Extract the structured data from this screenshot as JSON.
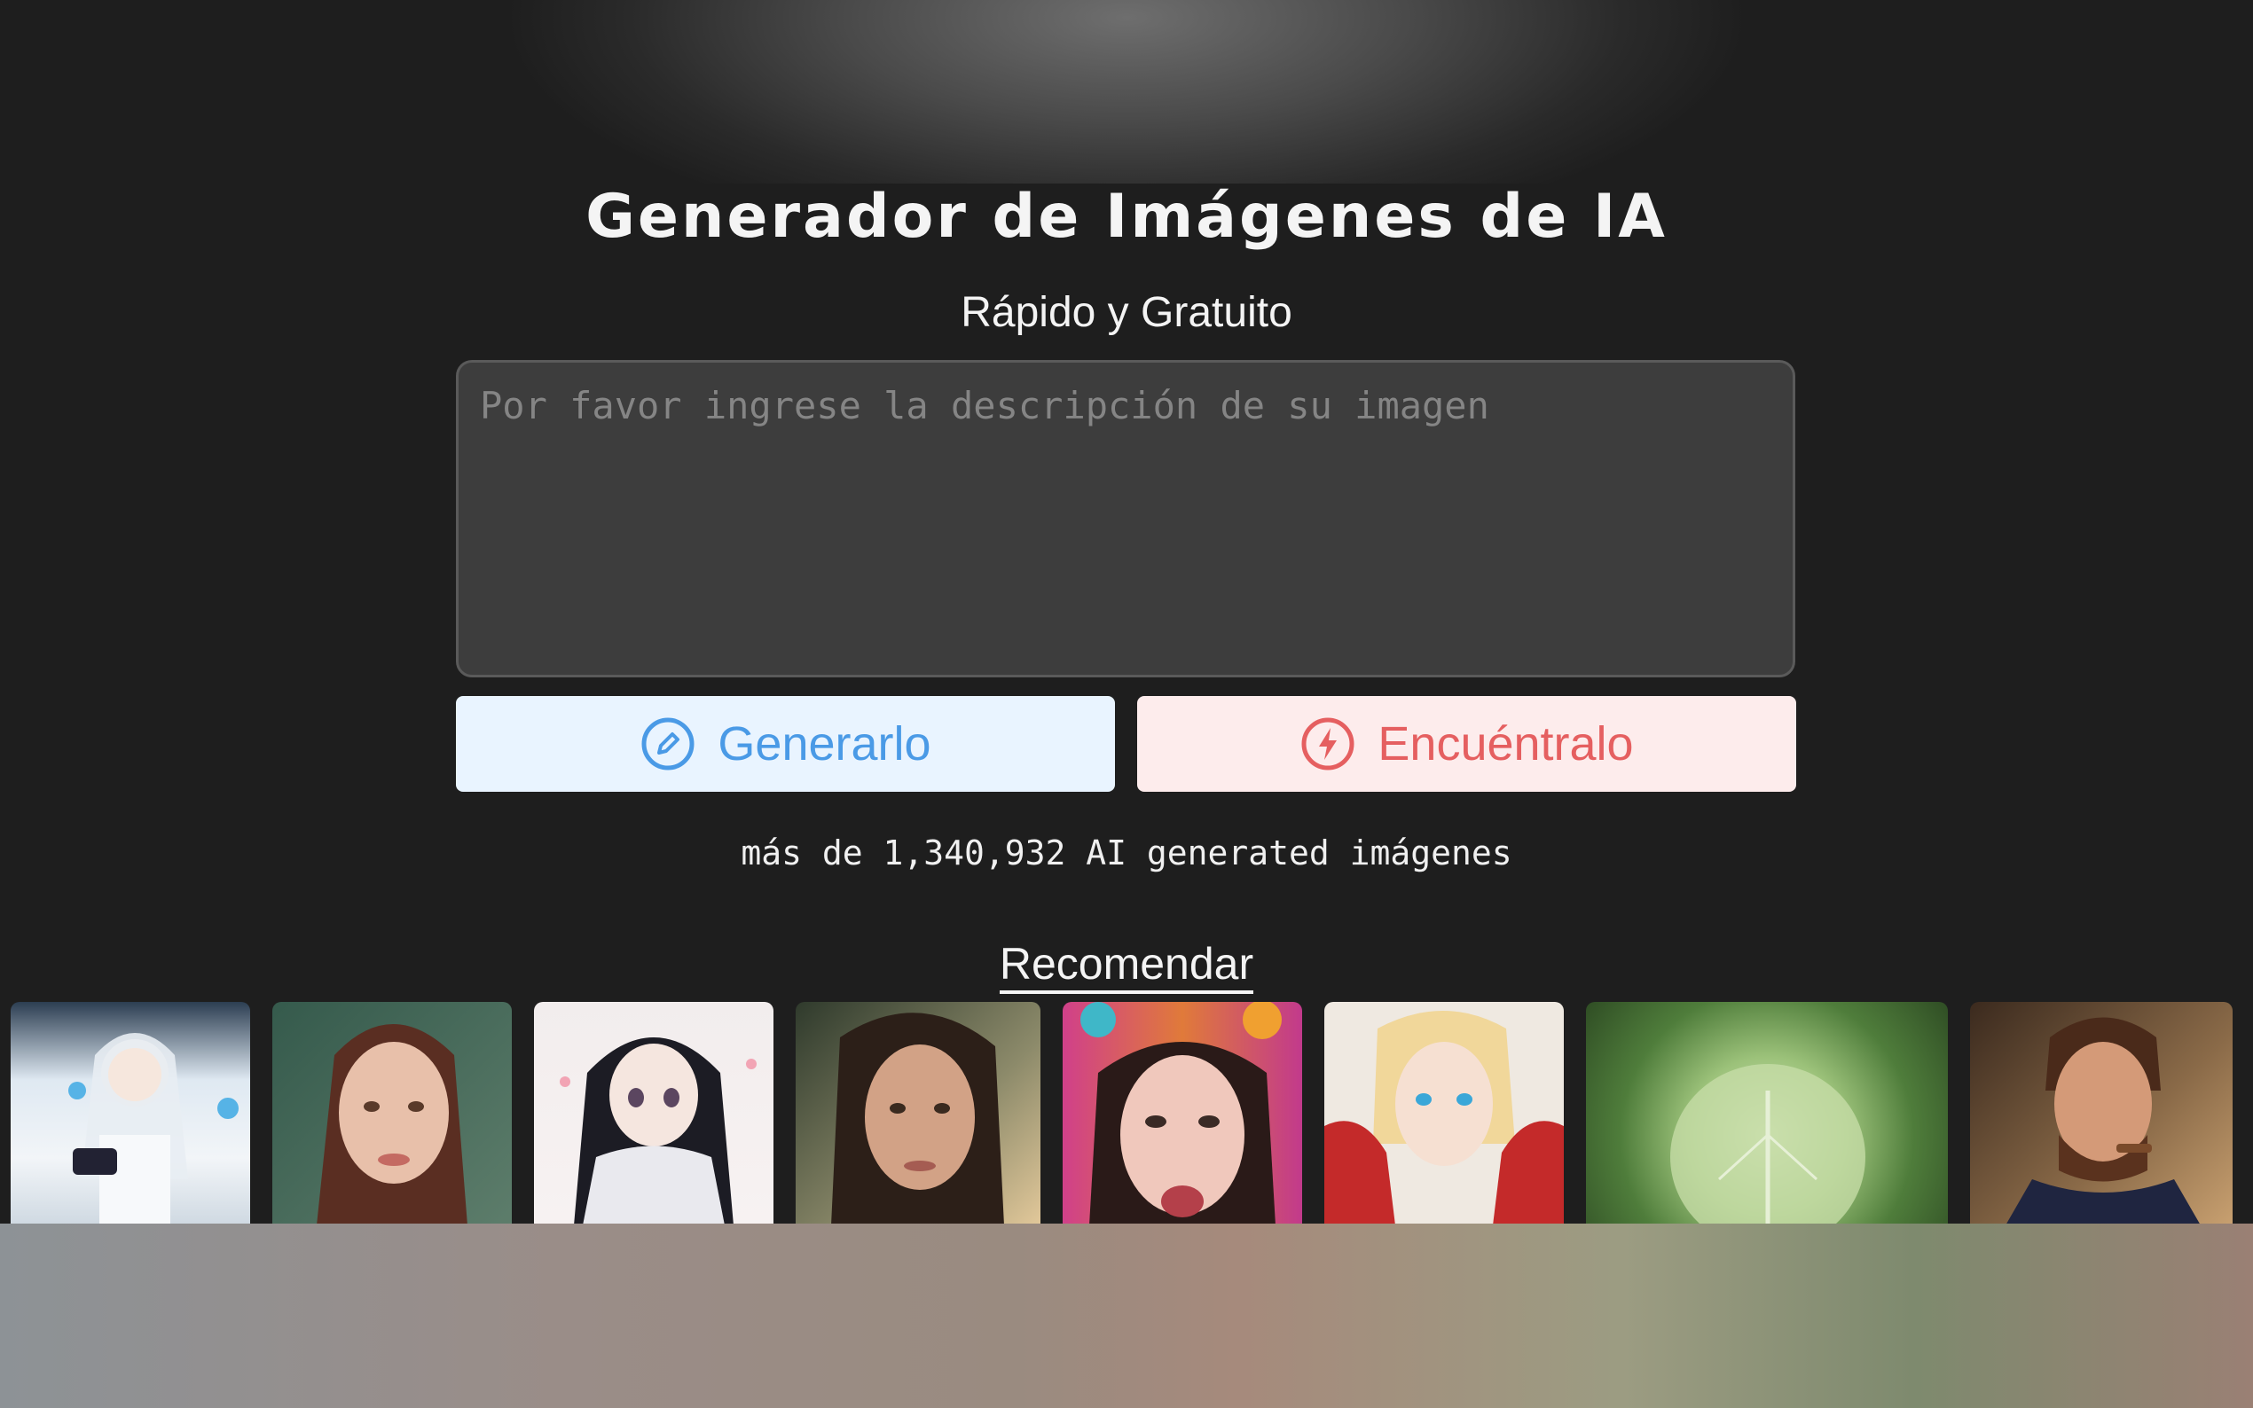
{
  "header": {
    "title": "Generador de Imágenes de IA",
    "subtitle": "Rápido y Gratuito"
  },
  "prompt": {
    "placeholder": "Por favor ingrese la descripción de su imagen",
    "value": ""
  },
  "actions": {
    "generate_label": "Generarlo",
    "generate_icon": "pencil-circle-icon",
    "find_label": "Encuéntralo",
    "find_icon": "lightning-circle-icon"
  },
  "stats": {
    "count_text": "más de 1,340,932 AI generated imágenes"
  },
  "recommend": {
    "heading": "Recomendar",
    "images": [
      {
        "subject": "anime girl white hair butterflies"
      },
      {
        "subject": "woman brown braided hair"
      },
      {
        "subject": "anime girl black hair hoodie"
      },
      {
        "subject": "woman long dark hair"
      },
      {
        "subject": "woman flowers background"
      },
      {
        "subject": "anime man blond hair red coat"
      },
      {
        "subject": "cabbage"
      },
      {
        "subject": "man smoking cigar suit"
      }
    ]
  },
  "colors": {
    "background": "#1e1e1e",
    "generate_accent": "#4a9ae6",
    "generate_bg": "#e9f4ff",
    "find_accent": "#e55f60",
    "find_bg": "#fdecec"
  }
}
